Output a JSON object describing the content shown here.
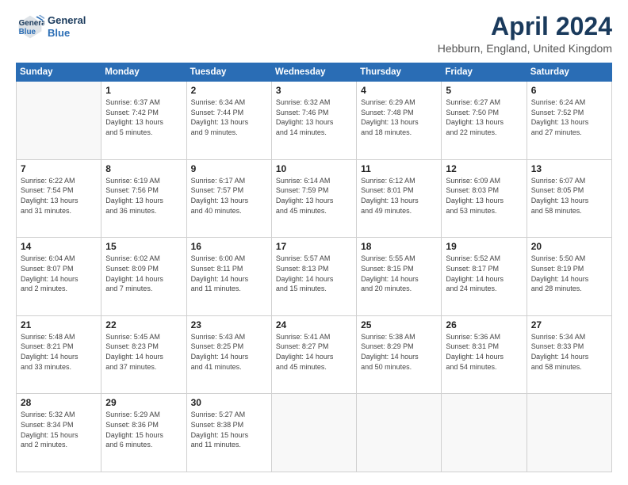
{
  "header": {
    "logo_line1": "General",
    "logo_line2": "Blue",
    "month_title": "April 2024",
    "location": "Hebburn, England, United Kingdom"
  },
  "days_of_week": [
    "Sunday",
    "Monday",
    "Tuesday",
    "Wednesday",
    "Thursday",
    "Friday",
    "Saturday"
  ],
  "weeks": [
    [
      {
        "day": "",
        "text": ""
      },
      {
        "day": "1",
        "text": "Sunrise: 6:37 AM\nSunset: 7:42 PM\nDaylight: 13 hours\nand 5 minutes."
      },
      {
        "day": "2",
        "text": "Sunrise: 6:34 AM\nSunset: 7:44 PM\nDaylight: 13 hours\nand 9 minutes."
      },
      {
        "day": "3",
        "text": "Sunrise: 6:32 AM\nSunset: 7:46 PM\nDaylight: 13 hours\nand 14 minutes."
      },
      {
        "day": "4",
        "text": "Sunrise: 6:29 AM\nSunset: 7:48 PM\nDaylight: 13 hours\nand 18 minutes."
      },
      {
        "day": "5",
        "text": "Sunrise: 6:27 AM\nSunset: 7:50 PM\nDaylight: 13 hours\nand 22 minutes."
      },
      {
        "day": "6",
        "text": "Sunrise: 6:24 AM\nSunset: 7:52 PM\nDaylight: 13 hours\nand 27 minutes."
      }
    ],
    [
      {
        "day": "7",
        "text": "Sunrise: 6:22 AM\nSunset: 7:54 PM\nDaylight: 13 hours\nand 31 minutes."
      },
      {
        "day": "8",
        "text": "Sunrise: 6:19 AM\nSunset: 7:56 PM\nDaylight: 13 hours\nand 36 minutes."
      },
      {
        "day": "9",
        "text": "Sunrise: 6:17 AM\nSunset: 7:57 PM\nDaylight: 13 hours\nand 40 minutes."
      },
      {
        "day": "10",
        "text": "Sunrise: 6:14 AM\nSunset: 7:59 PM\nDaylight: 13 hours\nand 45 minutes."
      },
      {
        "day": "11",
        "text": "Sunrise: 6:12 AM\nSunset: 8:01 PM\nDaylight: 13 hours\nand 49 minutes."
      },
      {
        "day": "12",
        "text": "Sunrise: 6:09 AM\nSunset: 8:03 PM\nDaylight: 13 hours\nand 53 minutes."
      },
      {
        "day": "13",
        "text": "Sunrise: 6:07 AM\nSunset: 8:05 PM\nDaylight: 13 hours\nand 58 minutes."
      }
    ],
    [
      {
        "day": "14",
        "text": "Sunrise: 6:04 AM\nSunset: 8:07 PM\nDaylight: 14 hours\nand 2 minutes."
      },
      {
        "day": "15",
        "text": "Sunrise: 6:02 AM\nSunset: 8:09 PM\nDaylight: 14 hours\nand 7 minutes."
      },
      {
        "day": "16",
        "text": "Sunrise: 6:00 AM\nSunset: 8:11 PM\nDaylight: 14 hours\nand 11 minutes."
      },
      {
        "day": "17",
        "text": "Sunrise: 5:57 AM\nSunset: 8:13 PM\nDaylight: 14 hours\nand 15 minutes."
      },
      {
        "day": "18",
        "text": "Sunrise: 5:55 AM\nSunset: 8:15 PM\nDaylight: 14 hours\nand 20 minutes."
      },
      {
        "day": "19",
        "text": "Sunrise: 5:52 AM\nSunset: 8:17 PM\nDaylight: 14 hours\nand 24 minutes."
      },
      {
        "day": "20",
        "text": "Sunrise: 5:50 AM\nSunset: 8:19 PM\nDaylight: 14 hours\nand 28 minutes."
      }
    ],
    [
      {
        "day": "21",
        "text": "Sunrise: 5:48 AM\nSunset: 8:21 PM\nDaylight: 14 hours\nand 33 minutes."
      },
      {
        "day": "22",
        "text": "Sunrise: 5:45 AM\nSunset: 8:23 PM\nDaylight: 14 hours\nand 37 minutes."
      },
      {
        "day": "23",
        "text": "Sunrise: 5:43 AM\nSunset: 8:25 PM\nDaylight: 14 hours\nand 41 minutes."
      },
      {
        "day": "24",
        "text": "Sunrise: 5:41 AM\nSunset: 8:27 PM\nDaylight: 14 hours\nand 45 minutes."
      },
      {
        "day": "25",
        "text": "Sunrise: 5:38 AM\nSunset: 8:29 PM\nDaylight: 14 hours\nand 50 minutes."
      },
      {
        "day": "26",
        "text": "Sunrise: 5:36 AM\nSunset: 8:31 PM\nDaylight: 14 hours\nand 54 minutes."
      },
      {
        "day": "27",
        "text": "Sunrise: 5:34 AM\nSunset: 8:33 PM\nDaylight: 14 hours\nand 58 minutes."
      }
    ],
    [
      {
        "day": "28",
        "text": "Sunrise: 5:32 AM\nSunset: 8:34 PM\nDaylight: 15 hours\nand 2 minutes."
      },
      {
        "day": "29",
        "text": "Sunrise: 5:29 AM\nSunset: 8:36 PM\nDaylight: 15 hours\nand 6 minutes."
      },
      {
        "day": "30",
        "text": "Sunrise: 5:27 AM\nSunset: 8:38 PM\nDaylight: 15 hours\nand 11 minutes."
      },
      {
        "day": "",
        "text": ""
      },
      {
        "day": "",
        "text": ""
      },
      {
        "day": "",
        "text": ""
      },
      {
        "day": "",
        "text": ""
      }
    ]
  ]
}
